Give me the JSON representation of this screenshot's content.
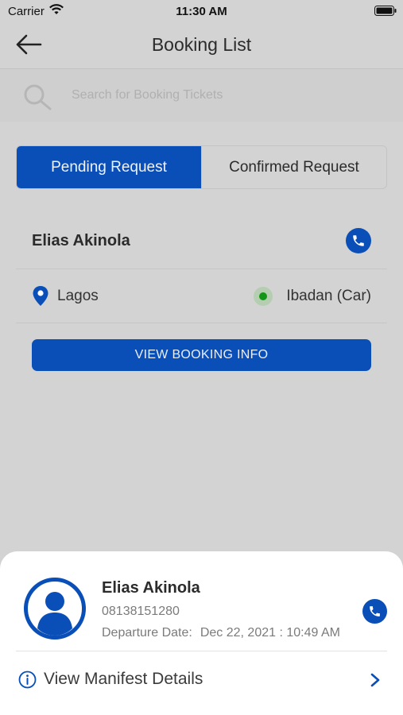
{
  "status_bar": {
    "carrier": "Carrier",
    "time": "11:30 AM"
  },
  "nav": {
    "title": "Booking List",
    "back_icon": "arrow-left-icon"
  },
  "search": {
    "placeholder": "Search for Booking Tickets",
    "icon": "search-icon"
  },
  "tabs": [
    {
      "label": "Pending Request",
      "active": true
    },
    {
      "label": "Confirmed Request",
      "active": false
    }
  ],
  "booking": {
    "name": "Elias Akinola",
    "from": "Lagos",
    "to": "Ibadan (Car)",
    "button_label": "VIEW BOOKING INFO"
  },
  "sheet": {
    "name": "Elias Akinola",
    "phone": "08138151280",
    "departure_label": "Departure Date:",
    "departure_value": "Dec 22, 2021 : 10:49 AM",
    "manifest_label": "View Manifest Details"
  },
  "colors": {
    "accent": "#0a4fb8",
    "overlay": "#d3d3d3",
    "status_dot": "#129618"
  }
}
